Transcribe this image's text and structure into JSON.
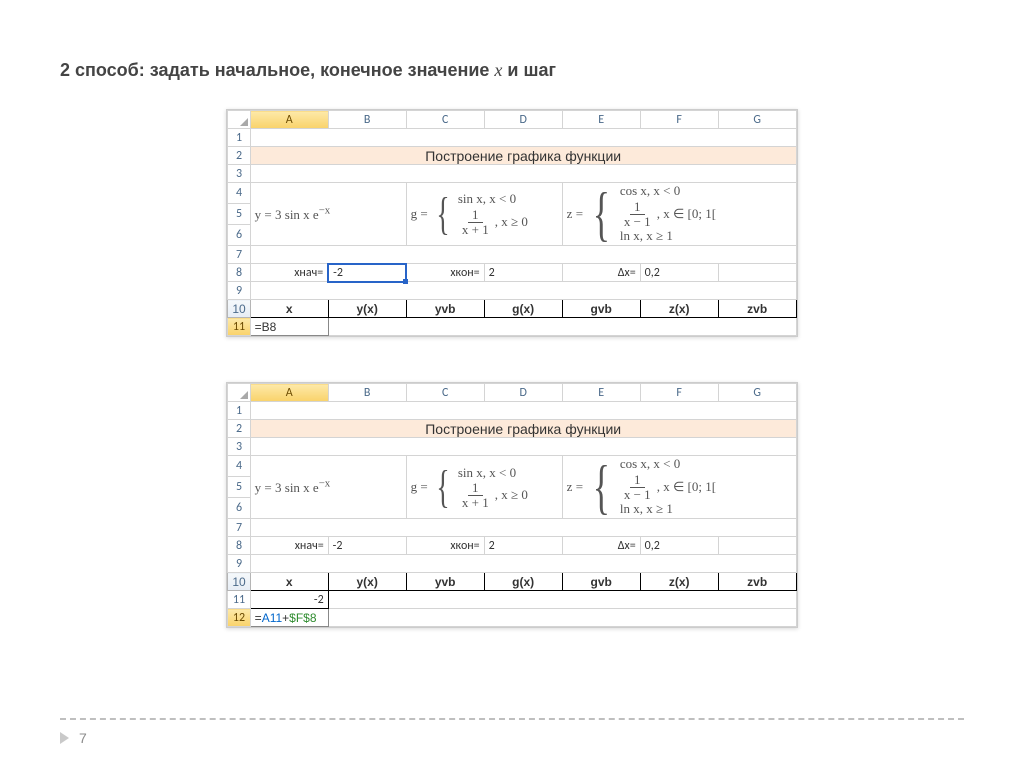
{
  "heading": {
    "prefix": "2 способ: задать начальное, конечное значение ",
    "xvar": "x",
    "suffix": " и шаг"
  },
  "columns": [
    "A",
    "B",
    "C",
    "D",
    "E",
    "F",
    "G"
  ],
  "title_text": "Построение графика функции",
  "eq": {
    "y_lhs": "y = 3 sin x e",
    "y_sup": "−x",
    "g_lhs": "g =",
    "g_line1": "sin x, x < 0",
    "g_frac_num": "1",
    "g_frac_den": "x + 1",
    "g_cond2": ", x ≥ 0",
    "z_lhs": "z =",
    "z_line1": "cos x, x < 0",
    "z_frac_num": "1",
    "z_frac_den": "x − 1",
    "z_cond2": ", x ∈ [0; 1[",
    "z_line3": "ln x, x ≥ 1"
  },
  "labels": {
    "xstart": "xнач=",
    "xend": "xкон=",
    "dx": "Δx="
  },
  "values": {
    "xstart": "-2",
    "xend": "2",
    "dx": "0,2"
  },
  "fn_headers": [
    "x",
    "y(x)",
    "yvb",
    "g(x)",
    "gvb",
    "z(x)",
    "zvb"
  ],
  "shot1": {
    "rows": [
      "1",
      "2",
      "3",
      "4",
      "5",
      "6",
      "7",
      "8",
      "9",
      "10",
      "11"
    ],
    "selected_row": "11",
    "selected_col": "A",
    "formula_text": "=B8"
  },
  "shot2": {
    "rows": [
      "1",
      "2",
      "3",
      "4",
      "5",
      "6",
      "7",
      "8",
      "9",
      "10",
      "11",
      "12"
    ],
    "selected_row": "12",
    "selected_col": "A",
    "row11_val": "-2",
    "formula_prefix": "=",
    "formula_ref1": "A11",
    "formula_plus": "+",
    "formula_ref2": "$F$8"
  },
  "page_number": "7"
}
